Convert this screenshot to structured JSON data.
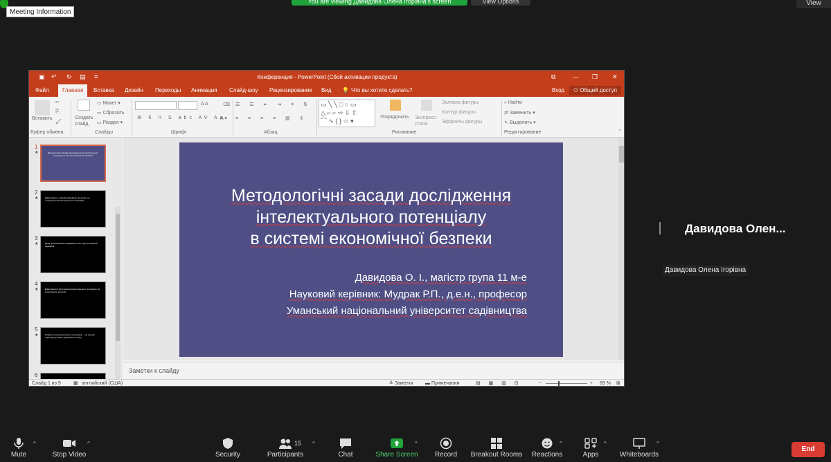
{
  "zoom": {
    "meeting_info": "Meeting Information",
    "viewing_banner": "You are viewing Давидова Олена Ігорівна's screen",
    "view_options": "View Options",
    "view_top": "View",
    "participant_name_large": "Давидова Олен...",
    "participant_name_small": "Давидова Олена Ігорівна",
    "toolbar": [
      {
        "label": "Mute",
        "icon": "microphone-icon"
      },
      {
        "label": "Stop Video",
        "icon": "video-camera-icon"
      },
      {
        "label": "Security",
        "icon": "shield-icon"
      },
      {
        "label": "Participants",
        "icon": "participants-icon",
        "count": "15"
      },
      {
        "label": "Chat",
        "icon": "chat-bubble-icon"
      },
      {
        "label": "Share Screen",
        "icon": "share-screen-icon"
      },
      {
        "label": "Record",
        "icon": "record-icon"
      },
      {
        "label": "Breakout Rooms",
        "icon": "breakout-rooms-icon"
      },
      {
        "label": "Reactions",
        "icon": "reactions-icon"
      },
      {
        "label": "Apps",
        "icon": "apps-icon"
      },
      {
        "label": "Whiteboards",
        "icon": "whiteboard-icon"
      }
    ],
    "end_label": "End",
    "colors": {
      "share_green": "#1fa33a",
      "end_red": "#d93c33",
      "bg": "#1a1a1a"
    }
  },
  "ppt": {
    "window_title": "Конференция - PowerPoint (Сбой активации продукта)",
    "tabs": [
      "Файл",
      "Главная",
      "Вставка",
      "Дизайн",
      "Переходы",
      "Анимация",
      "Слайд-шоу",
      "Рецензирование",
      "Вид"
    ],
    "tell_me": "Что вы хотите сделать?",
    "login": "Вход",
    "share": "Общий доступ",
    "ribbon": {
      "paste": "Вставить",
      "clipboard_group": "Буфер обмена",
      "new_slide": "Создать слайд",
      "layout": "Макет",
      "reset": "Сбросить",
      "section": "Раздел",
      "slides_group": "Слайды",
      "font_group": "Шрифт",
      "paragraph_group": "Абзац",
      "arrange": "Упорядочить",
      "quick_styles": "Экспресс-стили",
      "shape_fill": "Заливка фигуры",
      "shape_outline": "Контур фигуры",
      "shape_effects": "Эффекты фигуры",
      "drawing_group": "Рисование",
      "find": "Найти",
      "replace": "Заменить",
      "select": "Выделить",
      "editing_group": "Редактирование"
    },
    "thumbnails": [
      {
        "num": "1",
        "text": "Методологічні засади дослідження інтелектуального потенціалу в системі економічної безпеки"
      },
      {
        "num": "2",
        "text": "Ефективність трансформаційних процесів, що стосуються інтелектуального потенціалу"
      },
      {
        "num": "3",
        "text": "Дана проблематика перебуває в полі зору вітчизняних науковців"
      },
      {
        "num": "4",
        "text": "Ефективність залучення інтелектуального потенціалу до економічних процесів"
      },
      {
        "num": "5",
        "text": "Розвиток інтелектуального потенціалу — це процес переходу до більш досконалого стану"
      },
      {
        "num": "6",
        "text": ""
      }
    ],
    "slide": {
      "title_lines": [
        "Методологічні засади дослідження",
        "інтелектуального потенціалу",
        "в системі економічної безпеки"
      ],
      "sub_lines": [
        "Давидова О. І., магістр група 11 м-е",
        "Науковий керівник: Мудрак Р.П., д.е.н., професор",
        "Уманський національний університет садівництва"
      ],
      "bg_color": "#4f4e85"
    },
    "notes_placeholder": "Заметки к слайду",
    "status": {
      "slide_of": "Слайд 1 из 9",
      "language": "английский (США)",
      "notes": "Заметки",
      "comments": "Примечания",
      "zoom": "69 %"
    },
    "colors": {
      "accent": "#c43e1c"
    }
  }
}
